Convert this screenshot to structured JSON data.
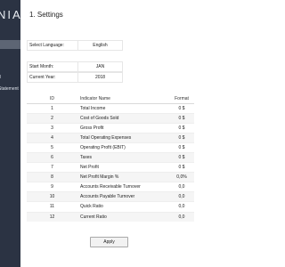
{
  "app": {
    "brand": "NIA"
  },
  "sidebar": {
    "items": [
      {
        "label": ""
      },
      {
        "label": ""
      },
      {
        "label": "d"
      },
      {
        "label": "Statement"
      }
    ]
  },
  "page": {
    "title": "1. Settings"
  },
  "settings": {
    "language": {
      "label": "Select Language:",
      "value": "English"
    },
    "start_month": {
      "label": "Start Month:",
      "value": "JAN"
    },
    "current_year": {
      "label": "Current Year:",
      "value": "2018"
    }
  },
  "table": {
    "headers": {
      "id": "ID",
      "indicator": "Indicator Name",
      "format": "Format"
    },
    "rows": [
      {
        "id": "1",
        "name": "Total Income",
        "format": "0 $"
      },
      {
        "id": "2",
        "name": "Cost of Goods Sold",
        "format": "0 $"
      },
      {
        "id": "3",
        "name": "Gross Profit",
        "format": "0 $"
      },
      {
        "id": "4",
        "name": "Total Operating Expenses",
        "format": "0 $"
      },
      {
        "id": "5",
        "name": "Operating Profit (EBIT)",
        "format": "0 $"
      },
      {
        "id": "6",
        "name": "Taxes",
        "format": "0 $"
      },
      {
        "id": "7",
        "name": "Net Profit",
        "format": "0 $"
      },
      {
        "id": "8",
        "name": "Net Profit Margin %",
        "format": "0,0%"
      },
      {
        "id": "9",
        "name": "Accounts Receivable Turnover",
        "format": "0,0"
      },
      {
        "id": "10",
        "name": "Accounts Payable Turnover",
        "format": "0,0"
      },
      {
        "id": "11",
        "name": "Quick Ratio",
        "format": "0,0"
      },
      {
        "id": "12",
        "name": "Current Ratio",
        "format": "0,0"
      }
    ]
  },
  "actions": {
    "apply_label": "Apply"
  }
}
